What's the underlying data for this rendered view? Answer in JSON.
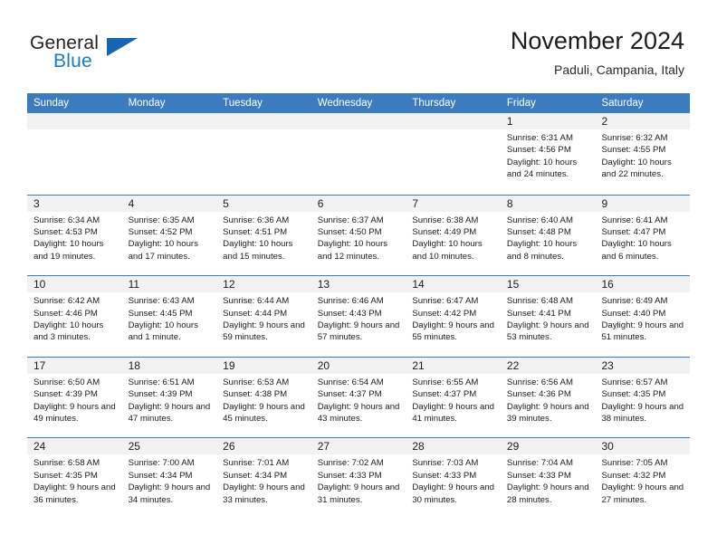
{
  "brand": {
    "name_top": "General",
    "name_bottom": "Blue",
    "triangle_color": "#1565b0",
    "blue_color": "#1a7ac4"
  },
  "header": {
    "title": "November 2024",
    "subtitle": "Paduli, Campania, Italy"
  },
  "theme": {
    "header_blue": "#3a7cbe",
    "daynum_band": "#f2f2f2",
    "text": "#1c1c1c"
  },
  "weekdays": [
    "Sunday",
    "Monday",
    "Tuesday",
    "Wednesday",
    "Thursday",
    "Friday",
    "Saturday"
  ],
  "weeks": [
    [
      {
        "day": "",
        "sunrise": "",
        "sunset": "",
        "daylight": ""
      },
      {
        "day": "",
        "sunrise": "",
        "sunset": "",
        "daylight": ""
      },
      {
        "day": "",
        "sunrise": "",
        "sunset": "",
        "daylight": ""
      },
      {
        "day": "",
        "sunrise": "",
        "sunset": "",
        "daylight": ""
      },
      {
        "day": "",
        "sunrise": "",
        "sunset": "",
        "daylight": ""
      },
      {
        "day": "1",
        "sunrise": "Sunrise: 6:31 AM",
        "sunset": "Sunset: 4:56 PM",
        "daylight": "Daylight: 10 hours and 24 minutes."
      },
      {
        "day": "2",
        "sunrise": "Sunrise: 6:32 AM",
        "sunset": "Sunset: 4:55 PM",
        "daylight": "Daylight: 10 hours and 22 minutes."
      }
    ],
    [
      {
        "day": "3",
        "sunrise": "Sunrise: 6:34 AM",
        "sunset": "Sunset: 4:53 PM",
        "daylight": "Daylight: 10 hours and 19 minutes."
      },
      {
        "day": "4",
        "sunrise": "Sunrise: 6:35 AM",
        "sunset": "Sunset: 4:52 PM",
        "daylight": "Daylight: 10 hours and 17 minutes."
      },
      {
        "day": "5",
        "sunrise": "Sunrise: 6:36 AM",
        "sunset": "Sunset: 4:51 PM",
        "daylight": "Daylight: 10 hours and 15 minutes."
      },
      {
        "day": "6",
        "sunrise": "Sunrise: 6:37 AM",
        "sunset": "Sunset: 4:50 PM",
        "daylight": "Daylight: 10 hours and 12 minutes."
      },
      {
        "day": "7",
        "sunrise": "Sunrise: 6:38 AM",
        "sunset": "Sunset: 4:49 PM",
        "daylight": "Daylight: 10 hours and 10 minutes."
      },
      {
        "day": "8",
        "sunrise": "Sunrise: 6:40 AM",
        "sunset": "Sunset: 4:48 PM",
        "daylight": "Daylight: 10 hours and 8 minutes."
      },
      {
        "day": "9",
        "sunrise": "Sunrise: 6:41 AM",
        "sunset": "Sunset: 4:47 PM",
        "daylight": "Daylight: 10 hours and 6 minutes."
      }
    ],
    [
      {
        "day": "10",
        "sunrise": "Sunrise: 6:42 AM",
        "sunset": "Sunset: 4:46 PM",
        "daylight": "Daylight: 10 hours and 3 minutes."
      },
      {
        "day": "11",
        "sunrise": "Sunrise: 6:43 AM",
        "sunset": "Sunset: 4:45 PM",
        "daylight": "Daylight: 10 hours and 1 minute."
      },
      {
        "day": "12",
        "sunrise": "Sunrise: 6:44 AM",
        "sunset": "Sunset: 4:44 PM",
        "daylight": "Daylight: 9 hours and 59 minutes."
      },
      {
        "day": "13",
        "sunrise": "Sunrise: 6:46 AM",
        "sunset": "Sunset: 4:43 PM",
        "daylight": "Daylight: 9 hours and 57 minutes."
      },
      {
        "day": "14",
        "sunrise": "Sunrise: 6:47 AM",
        "sunset": "Sunset: 4:42 PM",
        "daylight": "Daylight: 9 hours and 55 minutes."
      },
      {
        "day": "15",
        "sunrise": "Sunrise: 6:48 AM",
        "sunset": "Sunset: 4:41 PM",
        "daylight": "Daylight: 9 hours and 53 minutes."
      },
      {
        "day": "16",
        "sunrise": "Sunrise: 6:49 AM",
        "sunset": "Sunset: 4:40 PM",
        "daylight": "Daylight: 9 hours and 51 minutes."
      }
    ],
    [
      {
        "day": "17",
        "sunrise": "Sunrise: 6:50 AM",
        "sunset": "Sunset: 4:39 PM",
        "daylight": "Daylight: 9 hours and 49 minutes."
      },
      {
        "day": "18",
        "sunrise": "Sunrise: 6:51 AM",
        "sunset": "Sunset: 4:39 PM",
        "daylight": "Daylight: 9 hours and 47 minutes."
      },
      {
        "day": "19",
        "sunrise": "Sunrise: 6:53 AM",
        "sunset": "Sunset: 4:38 PM",
        "daylight": "Daylight: 9 hours and 45 minutes."
      },
      {
        "day": "20",
        "sunrise": "Sunrise: 6:54 AM",
        "sunset": "Sunset: 4:37 PM",
        "daylight": "Daylight: 9 hours and 43 minutes."
      },
      {
        "day": "21",
        "sunrise": "Sunrise: 6:55 AM",
        "sunset": "Sunset: 4:37 PM",
        "daylight": "Daylight: 9 hours and 41 minutes."
      },
      {
        "day": "22",
        "sunrise": "Sunrise: 6:56 AM",
        "sunset": "Sunset: 4:36 PM",
        "daylight": "Daylight: 9 hours and 39 minutes."
      },
      {
        "day": "23",
        "sunrise": "Sunrise: 6:57 AM",
        "sunset": "Sunset: 4:35 PM",
        "daylight": "Daylight: 9 hours and 38 minutes."
      }
    ],
    [
      {
        "day": "24",
        "sunrise": "Sunrise: 6:58 AM",
        "sunset": "Sunset: 4:35 PM",
        "daylight": "Daylight: 9 hours and 36 minutes."
      },
      {
        "day": "25",
        "sunrise": "Sunrise: 7:00 AM",
        "sunset": "Sunset: 4:34 PM",
        "daylight": "Daylight: 9 hours and 34 minutes."
      },
      {
        "day": "26",
        "sunrise": "Sunrise: 7:01 AM",
        "sunset": "Sunset: 4:34 PM",
        "daylight": "Daylight: 9 hours and 33 minutes."
      },
      {
        "day": "27",
        "sunrise": "Sunrise: 7:02 AM",
        "sunset": "Sunset: 4:33 PM",
        "daylight": "Daylight: 9 hours and 31 minutes."
      },
      {
        "day": "28",
        "sunrise": "Sunrise: 7:03 AM",
        "sunset": "Sunset: 4:33 PM",
        "daylight": "Daylight: 9 hours and 30 minutes."
      },
      {
        "day": "29",
        "sunrise": "Sunrise: 7:04 AM",
        "sunset": "Sunset: 4:33 PM",
        "daylight": "Daylight: 9 hours and 28 minutes."
      },
      {
        "day": "30",
        "sunrise": "Sunrise: 7:05 AM",
        "sunset": "Sunset: 4:32 PM",
        "daylight": "Daylight: 9 hours and 27 minutes."
      }
    ]
  ]
}
